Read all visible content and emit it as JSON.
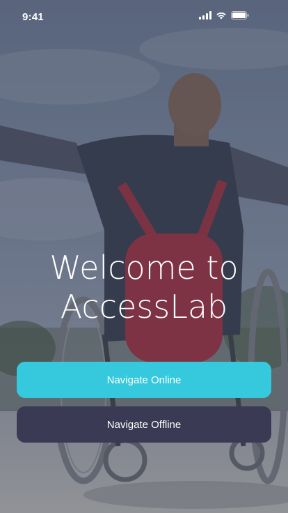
{
  "status_bar": {
    "time": "9:41",
    "icons": [
      "signal-icon",
      "wifi-icon",
      "battery-icon"
    ]
  },
  "welcome": {
    "line1": "Welcome to",
    "line2": "AccessLab"
  },
  "buttons": {
    "online_label": "Navigate Online",
    "offline_label": "Navigate Offline"
  },
  "colors": {
    "online_button": "#36c9dd",
    "offline_button": "#3b3a54",
    "text": "#ffffff"
  }
}
